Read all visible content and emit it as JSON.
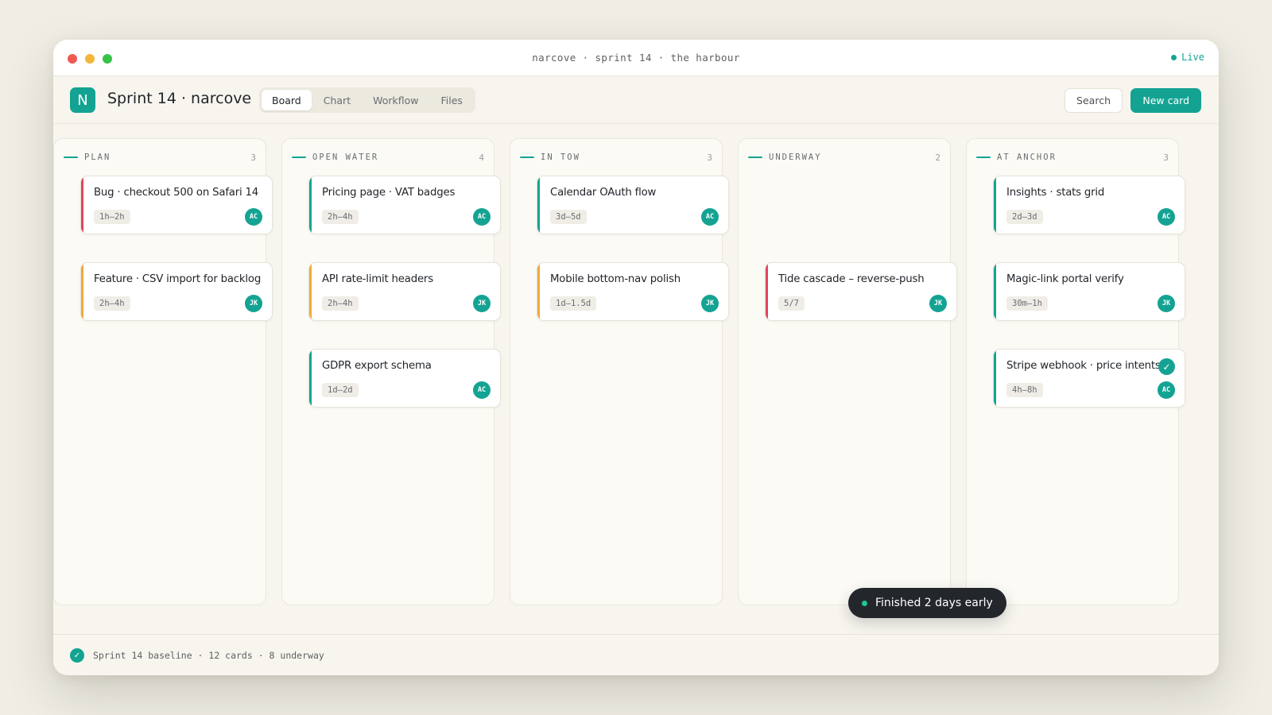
{
  "window": {
    "title": "narcove · sprint 14 · the harbour",
    "status": "Live"
  },
  "header": {
    "logo_letter": "N",
    "title": "Sprint 14 · narcove",
    "tabs": [
      {
        "label": "Board",
        "active": true
      },
      {
        "label": "Chart",
        "active": false
      },
      {
        "label": "Workflow",
        "active": false
      },
      {
        "label": "Files",
        "active": false
      }
    ],
    "search_label": "Search",
    "new_card_label": "New card"
  },
  "colors": {
    "accent": "#14a393",
    "stripe_red": "#e2445c",
    "stripe_orange": "#f0a93a",
    "stripe_teal": "#14a393"
  },
  "columns": [
    {
      "name": "PLAN",
      "count": "3",
      "cards": [
        {
          "title": "Bug · checkout 500 on Safari 14",
          "estimate": "1h–2h",
          "assignee": "AC",
          "stripe": "red"
        },
        {
          "title": "Feature · CSV import for backlog",
          "estimate": "2h–4h",
          "assignee": "JK",
          "stripe": "orange"
        }
      ]
    },
    {
      "name": "OPEN WATER",
      "count": "4",
      "cards": [
        {
          "title": "Pricing page · VAT badges",
          "estimate": "2h–4h",
          "assignee": "AC",
          "stripe": "teal"
        },
        {
          "title": "API rate-limit headers",
          "estimate": "2h–4h",
          "assignee": "JK",
          "stripe": "orange"
        },
        {
          "title": "GDPR export schema",
          "estimate": "1d–2d",
          "assignee": "AC",
          "stripe": "teal"
        }
      ]
    },
    {
      "name": "IN TOW",
      "count": "3",
      "cards": [
        {
          "title": "Calendar OAuth flow",
          "estimate": "3d–5d",
          "assignee": "AC",
          "stripe": "teal"
        },
        {
          "title": "Mobile bottom-nav polish",
          "estimate": "1d–1.5d",
          "assignee": "JK",
          "stripe": "orange"
        }
      ]
    },
    {
      "name": "UNDERWAY",
      "count": "2",
      "cards": [
        {
          "title": "Tide cascade – reverse-push",
          "estimate": "5/7",
          "assignee": "JK",
          "stripe": "red"
        }
      ]
    },
    {
      "name": "AT ANCHOR",
      "count": "3",
      "cards": [
        {
          "title": "Insights · stats grid",
          "estimate": "2d–3d",
          "assignee": "AC",
          "stripe": "teal"
        },
        {
          "title": "Magic-link portal verify",
          "estimate": "30m–1h",
          "assignee": "JK",
          "stripe": "teal"
        },
        {
          "title": "Stripe webhook · price intents",
          "estimate": "4h–8h",
          "assignee": "AC",
          "stripe": "teal",
          "done": true
        }
      ]
    }
  ],
  "toast": {
    "text": "Finished 2 days early"
  },
  "footer": {
    "text": "Sprint 14 baseline · 12 cards · 8 underway"
  }
}
